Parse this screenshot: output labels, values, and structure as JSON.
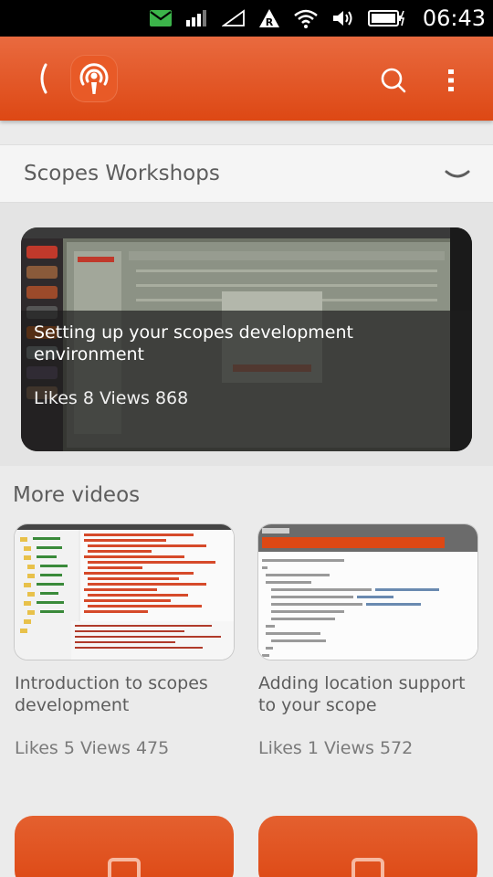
{
  "status_bar": {
    "time": "06:43",
    "icons": [
      "message-icon",
      "signal-icon",
      "mobile-data-icon",
      "roaming-icon",
      "wifi-icon",
      "volume-icon",
      "battery-charging-icon"
    ],
    "roaming_label": "R"
  },
  "header": {
    "back_icon": "back-chevron-icon",
    "logo_icon": "podcast-logo-icon",
    "search_icon": "search-icon",
    "menu_icon": "overflow-menu-icon"
  },
  "department": {
    "label": "Scopes Workshops",
    "chevron_icon": "chevron-down-icon"
  },
  "hero": {
    "title": "Setting up your scopes development environment",
    "meta": "Likes 8 Views 868"
  },
  "more_videos": {
    "title": "More videos",
    "items": [
      {
        "title": "Introduction to scopes development",
        "meta": "Likes 5 Views 475"
      },
      {
        "title": "Adding location support to your scope",
        "meta": "Likes 1 Views 572"
      }
    ]
  },
  "colors": {
    "accent": "#dd4814",
    "header_top": "#e96a3f",
    "background": "#ebebeb"
  }
}
